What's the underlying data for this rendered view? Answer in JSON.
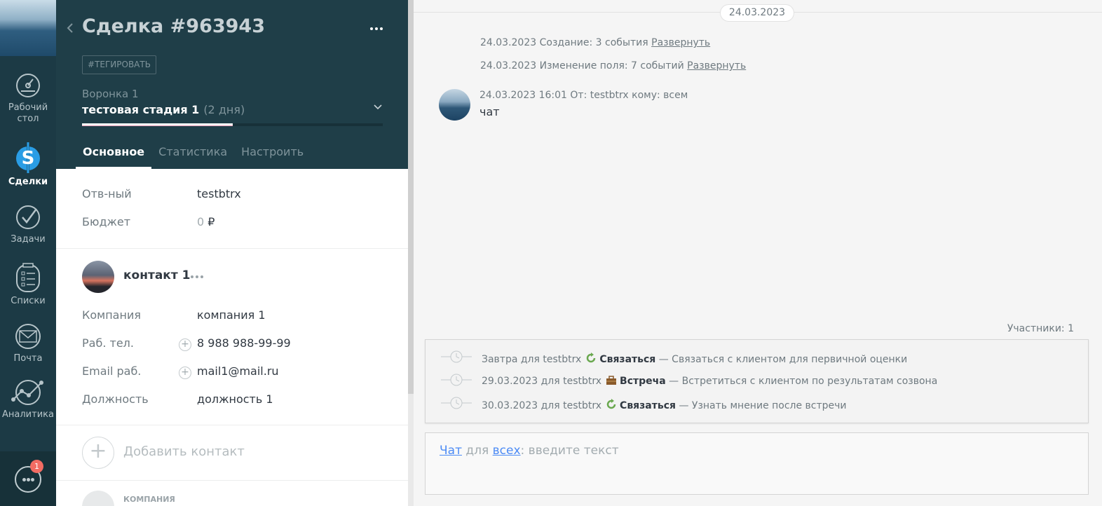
{
  "nav": {
    "items": [
      {
        "label_line1": "Рабочий",
        "label_line2": "стол",
        "icon": "dashboard-icon"
      },
      {
        "label": "Сделки",
        "icon": "dollar-icon"
      },
      {
        "label": "Задачи",
        "icon": "checkmark-icon"
      },
      {
        "label": "Списки",
        "icon": "list-icon"
      },
      {
        "label": "Почта",
        "icon": "envelope-icon"
      },
      {
        "label": "Аналитика",
        "icon": "chart-icon"
      }
    ],
    "chat_badge": "1"
  },
  "card": {
    "title": "Сделка #963943",
    "tag_button": "#ТЕГИРОВАТЬ",
    "funnel": "Воронка 1",
    "stage": "тестовая стадия 1",
    "stage_days": "(2 дня)",
    "stage_progress": 0.5,
    "tabs": [
      "Основное",
      "Статистика",
      "Настроить"
    ],
    "fields": {
      "responsible_label": "Отв-ный",
      "responsible_value": "testbtrx",
      "budget_label": "Бюджет",
      "budget_value": "0",
      "budget_currency": "₽"
    },
    "contact": {
      "name": "контакт 1",
      "company_label": "Компания",
      "company_value": "компания 1",
      "phone_label": "Раб. тел.",
      "phone_value": "8 988 988-99-99",
      "email_label": "Email раб.",
      "email_value": "mail1@mail.ru",
      "position_label": "Должность",
      "position_value": "должность 1"
    },
    "add_contact": "Добавить контакт",
    "company_section": "КОМПАНИЯ"
  },
  "feed": {
    "date": "24.03.2023",
    "events": [
      {
        "text": "24.03.2023 Создание: 3 события",
        "link": "Развернуть"
      },
      {
        "text": "24.03.2023 Изменение поля: 7 событий",
        "link": "Развернуть"
      }
    ],
    "message": {
      "meta": "24.03.2023 16:01 От: testbtrx кому: всем",
      "text": "чат"
    },
    "participants": "Участники: 1",
    "tasks": [
      {
        "when": "Завтра для testbtrx",
        "type": "Связаться",
        "desc": "— Связаться с клиентом для первичной оценки",
        "icon": "refresh-icon"
      },
      {
        "when": "29.03.2023 для testbtrx",
        "type": "Встреча",
        "desc": "— Встретиться с клиентом по результатам созвона",
        "icon": "briefcase-icon"
      },
      {
        "when": "30.03.2023 для testbtrx",
        "type": "Связаться",
        "desc": "— Узнать мнение после встречи",
        "icon": "refresh-icon"
      }
    ],
    "composer": {
      "chat_link": "Чат",
      "for_text": "для",
      "all_link": "всех",
      "placeholder": ": введите текст"
    }
  }
}
